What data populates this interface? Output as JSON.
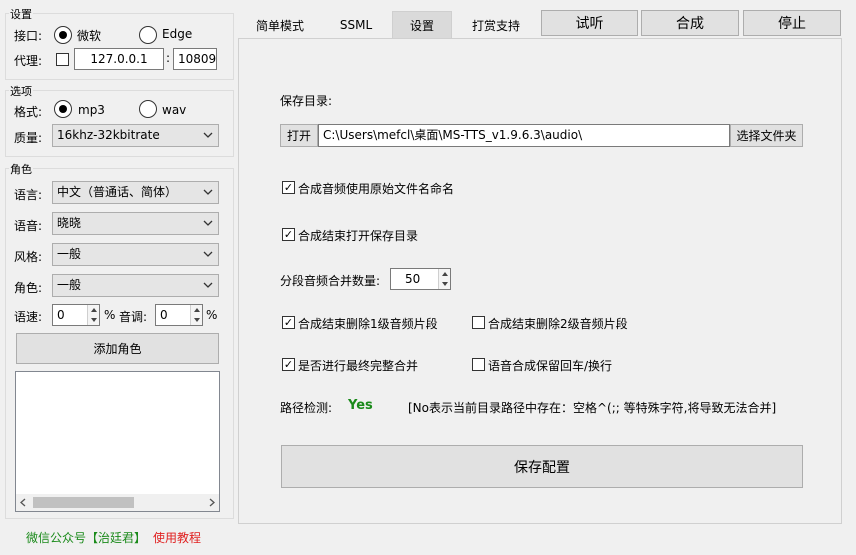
{
  "settings": {
    "group_title": "设置",
    "interface_label": "接口:",
    "interface_options": [
      {
        "label": "微软",
        "selected": true
      },
      {
        "label": "Edge",
        "selected": false
      }
    ],
    "proxy_label": "代理:",
    "proxy_enabled": false,
    "proxy_host": "127.0.0.1",
    "proxy_sep": ":",
    "proxy_port": "10809"
  },
  "options": {
    "group_title": "选项",
    "format_label": "格式:",
    "format_options": [
      {
        "label": "mp3",
        "selected": true
      },
      {
        "label": "wav",
        "selected": false
      }
    ],
    "quality_label": "质量:",
    "quality_value": "16khz-32kbitrate"
  },
  "role": {
    "group_title": "角色",
    "language_label": "语言:",
    "language_value": "中文（普通话、简体）",
    "voice_label": "语音:",
    "voice_value": "晓晓",
    "style_label": "风格:",
    "style_value": "一般",
    "role_label": "角色:",
    "role_value": "一般",
    "rate_label": "语速:",
    "rate_value": "0",
    "rate_unit": "%",
    "pitch_label": "音调:",
    "pitch_value": "0",
    "pitch_unit": "%",
    "add_role_button": "添加角色"
  },
  "footer": {
    "wechat_text": "微信公众号【治廷君】",
    "tutorial_link": "使用教程",
    "wechat_color": "#1a8a1a",
    "tutorial_color": "#e02020"
  },
  "tabs": [
    {
      "label": "简单模式",
      "active": false
    },
    {
      "label": "SSML",
      "active": false
    },
    {
      "label": "设置",
      "active": true
    },
    {
      "label": "打赏支持",
      "active": false
    }
  ],
  "toolbar": {
    "listen": "试听",
    "synthesize": "合成",
    "stop": "停止"
  },
  "settings_panel": {
    "save_dir_label": "保存目录:",
    "open_button": "打开",
    "save_dir_value": "C:\\Users\\mefcl\\桌面\\MS-TTS_v1.9.6.3\\audio\\",
    "choose_folder_button": "选择文件夹",
    "use_source_name": {
      "label": "合成音频使用原始文件名命名",
      "checked": true
    },
    "open_dir_after": {
      "label": "合成结束打开保存目录",
      "checked": true
    },
    "merge_count_label": "分段音频合并数量:",
    "merge_count_value": "50",
    "delete_level1": {
      "label": "合成结束删除1级音频片段",
      "checked": true
    },
    "delete_level2": {
      "label": "合成结束删除2级音频片段",
      "checked": false
    },
    "final_merge": {
      "label": "是否进行最终完整合并",
      "checked": true
    },
    "keep_newline": {
      "label": "语音合成保留回车/换行",
      "checked": false
    },
    "path_check_label": "路径检测:",
    "path_check_value": "Yes",
    "path_check_value_color": "#1a8a1a",
    "path_check_hint": "[No表示当前目录路径中存在：空格^(;; 等特殊字符,将导致无法合并]",
    "save_config_button": "保存配置"
  }
}
